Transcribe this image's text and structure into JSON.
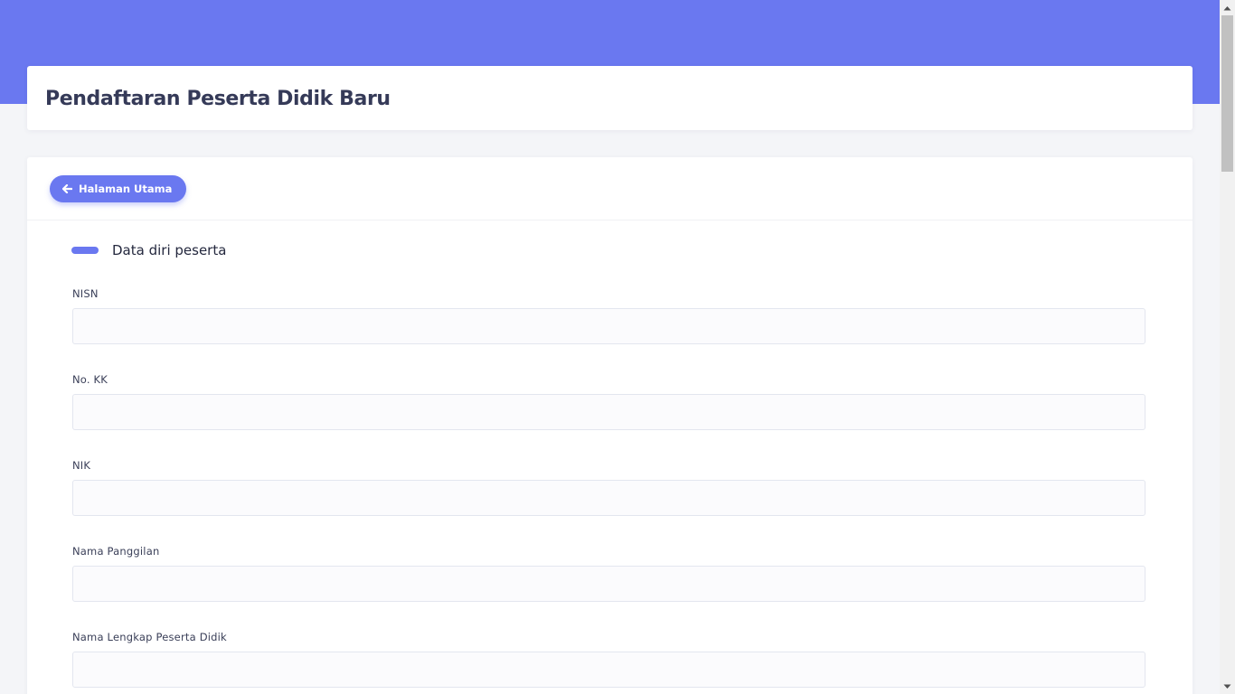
{
  "page": {
    "title": "Pendaftaran Peserta Didik Baru"
  },
  "nav": {
    "back_label": "Halaman Utama",
    "back_icon": "arrow-left-icon"
  },
  "section": {
    "title": "Data diri peserta"
  },
  "form": {
    "fields": [
      {
        "label": "NISN",
        "value": "",
        "placeholder": ""
      },
      {
        "label": "No. KK",
        "value": "",
        "placeholder": ""
      },
      {
        "label": "NIK",
        "value": "",
        "placeholder": ""
      },
      {
        "label": "Nama Panggilan",
        "value": "",
        "placeholder": ""
      },
      {
        "label": "Nama Lengkap Peserta Didik",
        "value": "",
        "placeholder": ""
      }
    ]
  },
  "colors": {
    "accent": "#6a78f0",
    "page_background": "#f4f5f8",
    "card_background": "#ffffff",
    "title_text": "#353a58"
  }
}
